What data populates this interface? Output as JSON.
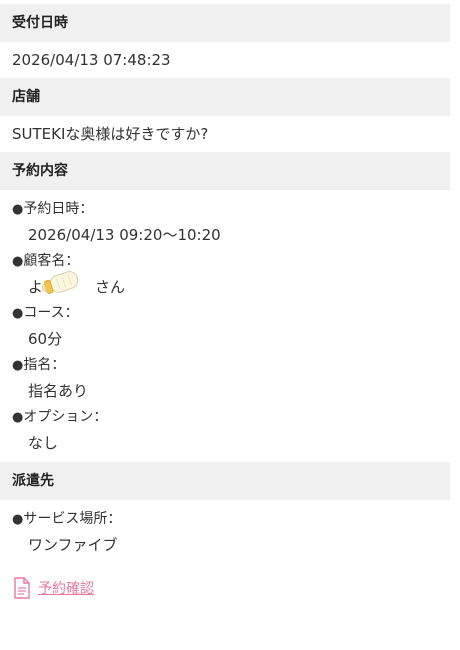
{
  "reception": {
    "label": "受付日時",
    "value": "2026/04/13 07:48:23"
  },
  "store": {
    "label": "店舗",
    "value": "SUTEKIな奥様は好きですか?"
  },
  "reservation": {
    "label": "予約内容",
    "items": [
      {
        "label": "予約日時：",
        "value": "2026/04/13 09:20〜10:20"
      },
      {
        "label": "顧客名：",
        "value_first": "よ",
        "value_last": "さん"
      },
      {
        "label": "コース：",
        "value": "60分"
      },
      {
        "label": "指名：",
        "value": "指名あり"
      },
      {
        "label": "オプション：",
        "value": "なし"
      }
    ]
  },
  "dispatch": {
    "label": "派遣先",
    "items": [
      {
        "label": "サービス場所：",
        "value": "ワンファイブ"
      }
    ]
  },
  "confirm_link": {
    "label": "予約確認",
    "icon": "document-icon",
    "color": "#e57aa0"
  },
  "bullet": "●",
  "masking_sticker_icon": "baby-bottle-icon"
}
